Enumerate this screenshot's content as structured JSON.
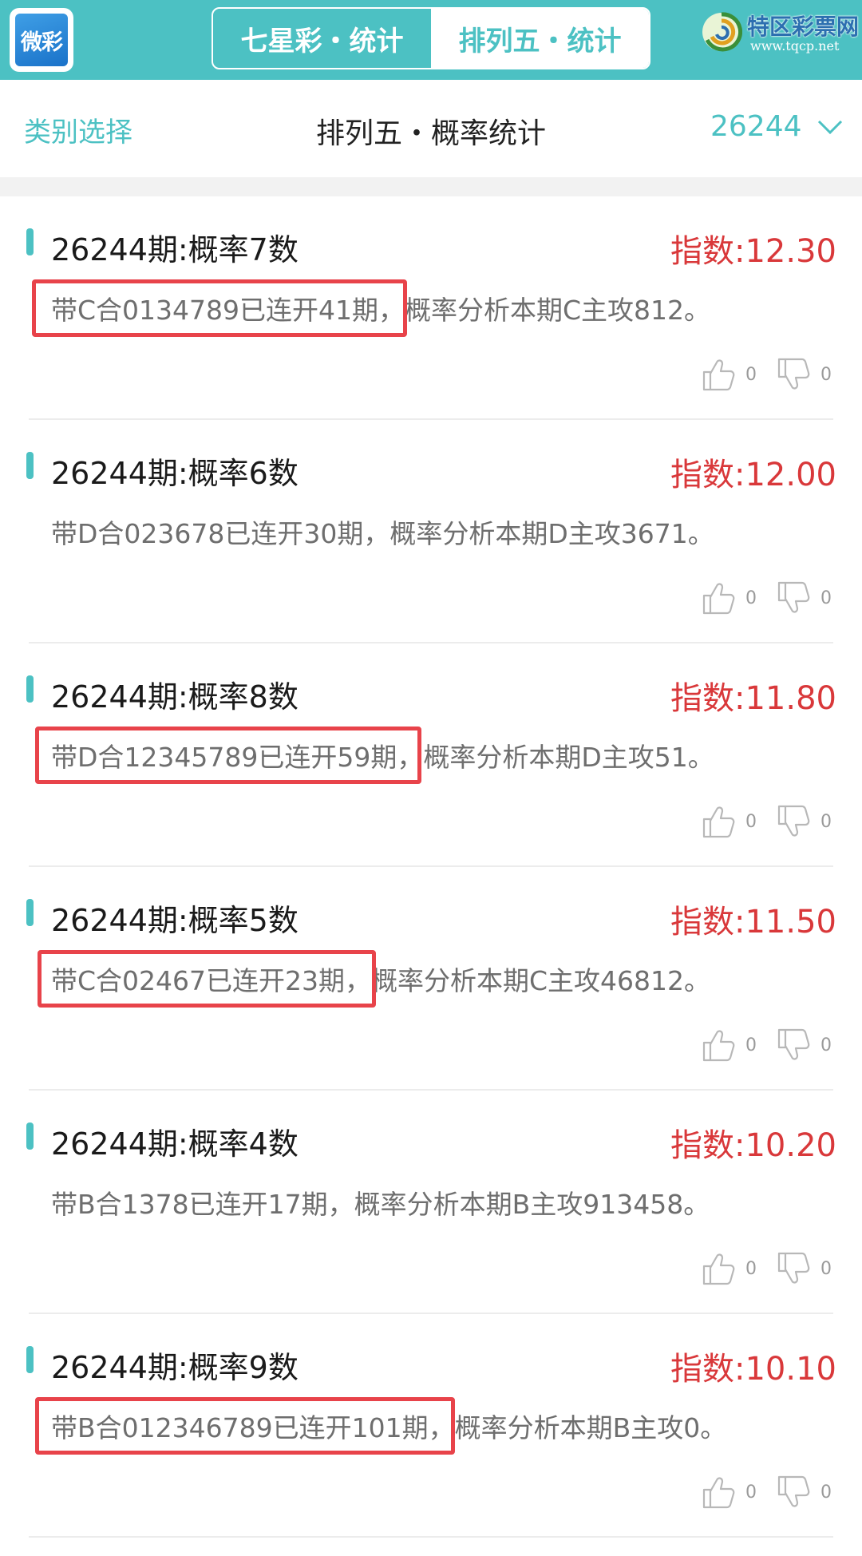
{
  "header": {
    "app_logo_text": "微彩",
    "tabs": [
      {
        "label": "七星彩・统计",
        "active": false
      },
      {
        "label": "排列五・统计",
        "active": true
      }
    ],
    "site_logo": {
      "name": "特区彩票网",
      "url": "www.tqcp.net"
    }
  },
  "subheader": {
    "category_select": "类别选择",
    "title": "排列五・概率统计",
    "issue": "26244"
  },
  "colors": {
    "accent": "#4cc1c3",
    "index_red": "#d9383a",
    "highlight_box": "#e8434a"
  },
  "cards": [
    {
      "title": "26244期:概率7数",
      "index": "指数:12.30",
      "desc": "带C合0134789已连开41期，概率分析本期C主攻812。",
      "likes": "0",
      "dislikes": "0",
      "highlighted": true
    },
    {
      "title": "26244期:概率6数",
      "index": "指数:12.00",
      "desc": "带D合023678已连开30期，概率分析本期D主攻3671。",
      "likes": "0",
      "dislikes": "0",
      "highlighted": false
    },
    {
      "title": "26244期:概率8数",
      "index": "指数:11.80",
      "desc": "带D合12345789已连开59期，概率分析本期D主攻51。",
      "likes": "0",
      "dislikes": "0",
      "highlighted": true
    },
    {
      "title": "26244期:概率5数",
      "index": "指数:11.50",
      "desc": "带C合02467已连开23期，概率分析本期C主攻46812。",
      "likes": "0",
      "dislikes": "0",
      "highlighted": true
    },
    {
      "title": "26244期:概率4数",
      "index": "指数:10.20",
      "desc": "带B合1378已连开17期，概率分析本期B主攻913458。",
      "likes": "0",
      "dislikes": "0",
      "highlighted": false
    },
    {
      "title": "26244期:概率9数",
      "index": "指数:10.10",
      "desc": "带B合012346789已连开101期，概率分析本期B主攻0。",
      "likes": "0",
      "dislikes": "0",
      "highlighted": true
    }
  ]
}
